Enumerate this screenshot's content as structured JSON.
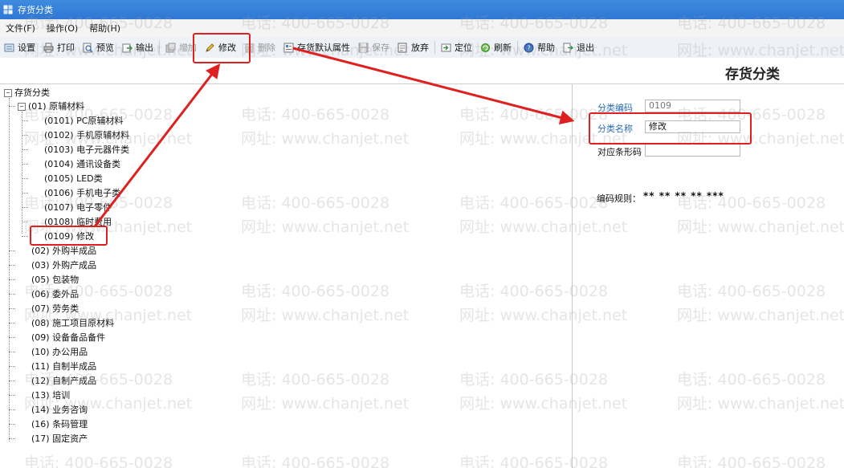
{
  "window": {
    "title": "存货分类"
  },
  "menu": [
    {
      "label": "文件(F)"
    },
    {
      "label": "操作(O)"
    },
    {
      "label": "帮助(H)"
    }
  ],
  "toolbar": {
    "setup": "设置",
    "print": "打印",
    "preview": "预览",
    "export": "输出",
    "add": "增加",
    "modify": "修改",
    "delete": "删除",
    "default_attr": "存货默认属性",
    "save": "保存",
    "discard": "放弃",
    "locate": "定位",
    "refresh": "刷新",
    "help": "帮助",
    "exit": "退出"
  },
  "page_title": "存货分类",
  "tree": {
    "root": "存货分类",
    "n01": "(01) 原辅材料",
    "c0101": "(0101) PC原辅材料",
    "c0102": "(0102) 手机原辅材料",
    "c0103": "(0103) 电子元器件类",
    "c0104": "(0104) 通讯设备类",
    "c0105": "(0105) LED类",
    "c0106": "(0106) 手机电子类",
    "c0107": "(0107) 电子零件",
    "c0108": "(0108) 临时费用",
    "c0109": "(0109) 修改",
    "n02": "(02) 外购半成品",
    "n03": "(03) 外购产成品",
    "n05": "(05) 包装物",
    "n06": "(06) 委外品",
    "n07": "(07) 劳务类",
    "n08": "(08) 施工项目原材料",
    "n09": "(09) 设备备品备件",
    "n10": "(10) 办公用品",
    "n11": "(11) 自制半成品",
    "n12": "(12) 自制产成品",
    "n13": "(13) 培训",
    "n14": "(14) 业务咨询",
    "n16": "(16) 条码管理",
    "n17": "(17) 固定资产"
  },
  "form": {
    "code_label": "分类编码",
    "code_value": "0109",
    "name_label": "分类名称",
    "name_value": "修改",
    "barcode_label": "对应条形码",
    "barcode_value": "",
    "rule_label": "编码规则：",
    "rule_value": "** ** ** ** ***"
  },
  "watermark": {
    "phone": "电话: 400-665-0028",
    "site": "网址: www.chanjet.net"
  },
  "colors": {
    "titlebar": "#3f8be0",
    "annotation": "#e02020",
    "label_blue": "#2a6db8"
  }
}
